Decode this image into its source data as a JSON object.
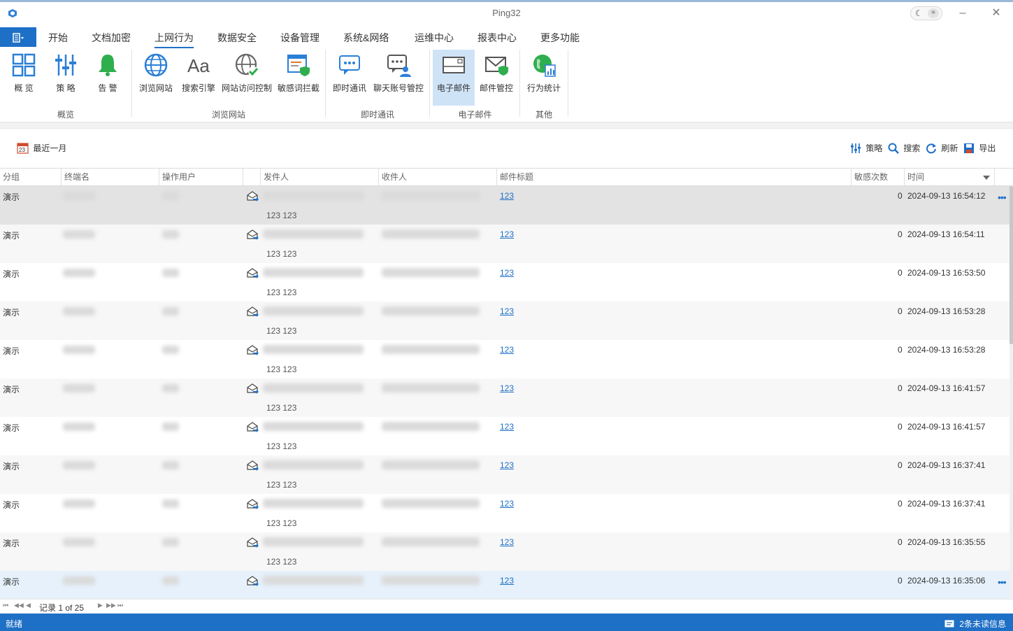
{
  "window": {
    "title": "Ping32"
  },
  "menu": {
    "file_icon": "menu-icon",
    "tabs": [
      {
        "label": "开始"
      },
      {
        "label": "文档加密"
      },
      {
        "label": "上网行为"
      },
      {
        "label": "数据安全"
      },
      {
        "label": "设备管理"
      },
      {
        "label": "系统&网络"
      },
      {
        "label": "运维中心"
      },
      {
        "label": "报表中心"
      },
      {
        "label": "更多功能"
      }
    ],
    "active": "上网行为"
  },
  "ribbon": {
    "buttons": [
      {
        "label": "概 览",
        "icon": "overview-grid-icon"
      },
      {
        "label": "策 略",
        "icon": "sliders-icon"
      },
      {
        "label": "告 警",
        "icon": "bell-icon"
      },
      {
        "label": "浏览网站",
        "icon": "globe-icon"
      },
      {
        "label": "搜索引擎",
        "icon": "font-aa-icon"
      },
      {
        "label": "网站访问控制",
        "icon": "globe-check-icon"
      },
      {
        "label": "敏感词拦截",
        "icon": "browser-shield-icon"
      },
      {
        "label": "即时通讯",
        "icon": "chat-icon"
      },
      {
        "label": "聊天账号管控",
        "icon": "chat-user-icon"
      },
      {
        "label": "电子邮件",
        "icon": "envelope-icon"
      },
      {
        "label": "邮件管控",
        "icon": "envelope-shield-icon"
      },
      {
        "label": "行为统计",
        "icon": "globe-stats-icon"
      }
    ],
    "groups": [
      {
        "label": "概览"
      },
      {
        "label": "浏览网站"
      },
      {
        "label": "即时通讯"
      },
      {
        "label": "电子邮件"
      },
      {
        "label": "其他"
      }
    ]
  },
  "toolbar": {
    "date_filter": "最近一月",
    "date_icon_text": "23",
    "policy": "策略",
    "search": "搜索",
    "refresh": "刷新",
    "export": "导出"
  },
  "grid": {
    "columns": [
      "分组",
      "终端名",
      "操作用户",
      "",
      "发件人",
      "收件人",
      "邮件标题",
      "敏感次数",
      "时间"
    ],
    "rows": [
      {
        "group": "演示",
        "subject": "123",
        "body": "123 123",
        "count": "0",
        "time": "2024-09-13 16:54:12"
      },
      {
        "group": "演示",
        "subject": "123",
        "body": "123 123",
        "count": "0",
        "time": "2024-09-13 16:54:11"
      },
      {
        "group": "演示",
        "subject": "123",
        "body": "123 123",
        "count": "0",
        "time": "2024-09-13 16:53:50"
      },
      {
        "group": "演示",
        "subject": "123",
        "body": "123 123",
        "count": "0",
        "time": "2024-09-13 16:53:28"
      },
      {
        "group": "演示",
        "subject": "123",
        "body": "123 123",
        "count": "0",
        "time": "2024-09-13 16:53:28"
      },
      {
        "group": "演示",
        "subject": "123",
        "body": "123 123",
        "count": "0",
        "time": "2024-09-13 16:41:57"
      },
      {
        "group": "演示",
        "subject": "123",
        "body": "123 123",
        "count": "0",
        "time": "2024-09-13 16:41:57"
      },
      {
        "group": "演示",
        "subject": "123",
        "body": "123 123",
        "count": "0",
        "time": "2024-09-13 16:37:41"
      },
      {
        "group": "演示",
        "subject": "123",
        "body": "123 123",
        "count": "0",
        "time": "2024-09-13 16:37:41"
      },
      {
        "group": "演示",
        "subject": "123",
        "body": "123 123",
        "count": "0",
        "time": "2024-09-13 16:35:55"
      },
      {
        "group": "演示",
        "subject": "123",
        "body": "",
        "count": "0",
        "time": "2024-09-13 16:35:06"
      }
    ],
    "more_icon": "•••"
  },
  "pager": {
    "record_text": "记录 1 of 25"
  },
  "status": {
    "left": "就绪",
    "right": "2条未读信息"
  },
  "colors": {
    "accent": "#1e6fc6",
    "selected_ribbon": "#cfe3f7"
  }
}
